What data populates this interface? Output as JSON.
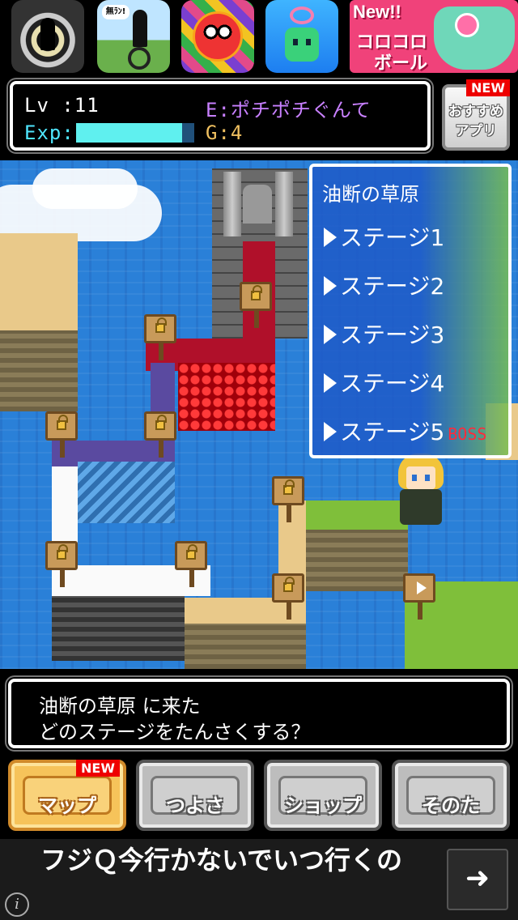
{
  "promo": {
    "icons": [
      {
        "name": "silhouette-run-game",
        "icon": "running-figure-icon"
      },
      {
        "name": "unicycle-game",
        "icon": "unicycle-figure-icon",
        "bubble": "無ﾗﾝ!"
      },
      {
        "name": "dragon-puzzle-game",
        "icon": "red-dragon-icon"
      },
      {
        "name": "balloon-robot-game",
        "icon": "green-robot-icon"
      }
    ],
    "banner": {
      "new_label": "New!!",
      "title_line1": "コロコロ",
      "title_line2": "ボール"
    }
  },
  "status": {
    "level_text": "Lv :11",
    "exp_label": "Exp:",
    "exp_fill": 0.9,
    "equipment_text": "E:ポチポチぐんて",
    "gold_text": "G:4"
  },
  "recommend": {
    "label_line1": "おすすめ",
    "label_line2": "アプリ",
    "badge": "NEW"
  },
  "stage_menu": {
    "area_title": "油断の草原",
    "stages": [
      {
        "label": "ステージ1",
        "tag": ""
      },
      {
        "label": "ステージ2",
        "tag": ""
      },
      {
        "label": "ステージ3",
        "tag": ""
      },
      {
        "label": "ステージ4",
        "tag": ""
      },
      {
        "label": "ステージ5",
        "tag": "BOSS"
      }
    ]
  },
  "message": {
    "line1": "油断の草原 に来た",
    "line2": "どのステージをたんさくする？"
  },
  "nav": {
    "map_label": "マップ",
    "map_badge": "NEW",
    "strength_label": "つよさ",
    "shop_label": "ショップ",
    "other_label": "そのた"
  },
  "ad": {
    "text": "フジＱ今行かないでいつ行くの",
    "arrow": "➜",
    "info": "i"
  },
  "colors": {
    "exp": "#5ff0ef",
    "equipment": "#c880ff",
    "gold": "#f0c060",
    "boss": "#ff2b3a",
    "new_badge": "#ee0000",
    "active_tab": "#f6c35a"
  }
}
